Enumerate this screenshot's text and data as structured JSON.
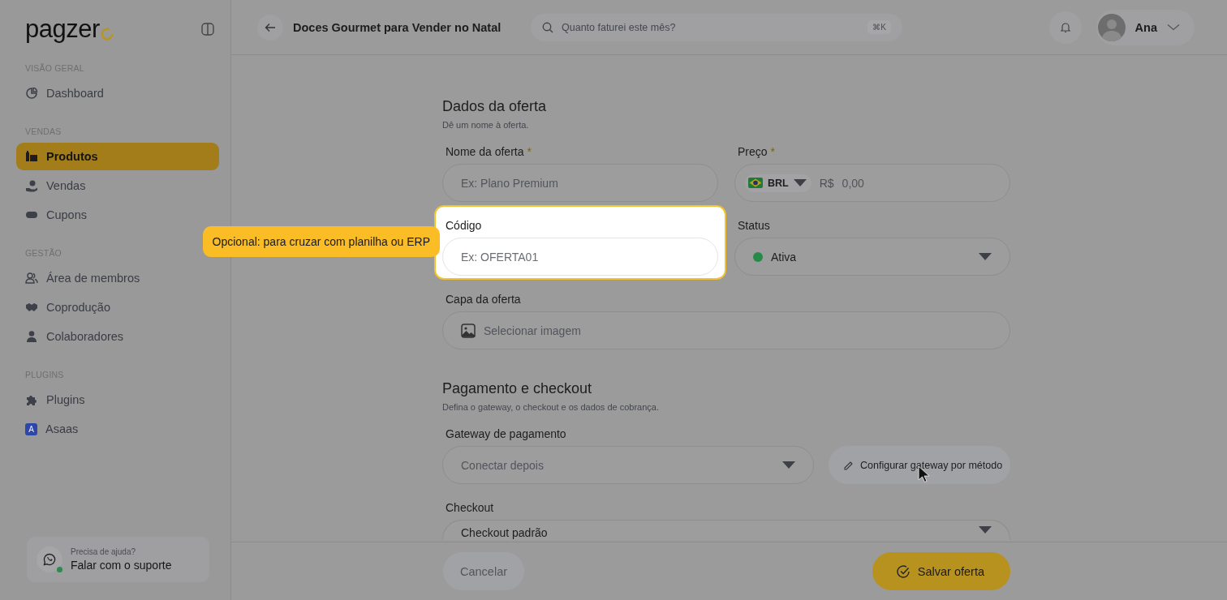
{
  "sidebar": {
    "logo": "pagzer",
    "sections": [
      {
        "title": "VISÃO GERAL",
        "items": [
          {
            "label": "Dashboard",
            "selected": false
          }
        ]
      },
      {
        "title": "VENDAS",
        "items": [
          {
            "label": "Produtos",
            "selected": true
          },
          {
            "label": "Vendas",
            "selected": false
          },
          {
            "label": "Cupons",
            "selected": false
          }
        ]
      },
      {
        "title": "GESTÃO",
        "items": [
          {
            "label": "Área de membros",
            "selected": false
          },
          {
            "label": "Coprodução",
            "selected": false
          },
          {
            "label": "Colaboradores",
            "selected": false
          }
        ]
      },
      {
        "title": "PLUGINS",
        "items": [
          {
            "label": "Plugins",
            "selected": false
          },
          {
            "label": "Asaas",
            "selected": false,
            "logo_letter": "A"
          }
        ]
      }
    ],
    "help": {
      "caption": "Precisa de ajuda?",
      "link": "Falar com o suporte"
    }
  },
  "header": {
    "title": "Doces Gourmet para Vender no Natal",
    "search": {
      "placeholder": "Quanto faturei este mês?",
      "shortcut": "⌘K"
    },
    "user": "Ana"
  },
  "sections": [
    {
      "title": "Dados da oferta",
      "subtitle": "Dê um nome à oferta.",
      "fields": [
        {
          "kind": "text",
          "label": "Nome da oferta",
          "required_mark": "*",
          "placeholder": "Ex: Plano Premium",
          "highlighted": false
        },
        {
          "kind": "price",
          "label": "Preço",
          "required_mark": "*",
          "currency": "BRL",
          "symbol": "R$",
          "placeholder": "0,00",
          "highlighted": false
        },
        {
          "kind": "text",
          "label": "Código",
          "placeholder": "Ex: OFERTA01",
          "highlighted": true,
          "tooltip": "Opcional: para cruzar com planilha ou ERP"
        },
        {
          "kind": "select",
          "label": "Status",
          "value": "Ativa",
          "highlighted": false
        },
        {
          "kind": "image",
          "label": "Capa da oferta",
          "placeholder": "Selecionar imagem",
          "highlighted": false
        }
      ]
    },
    {
      "title": "Pagamento e checkout",
      "subtitle": "Defina o gateway, o checkout e os dados de cobrança.",
      "fields": [
        {
          "kind": "gateway",
          "label": "Gateway de pagamento",
          "placeholder": "Conectar depois",
          "button": "Configurar gateway por método",
          "highlighted": false
        },
        {
          "kind": "select",
          "label": "Checkout",
          "value": "Checkout padrão",
          "highlighted": false
        }
      ]
    }
  ],
  "footer": {
    "cancel": "Cancelar",
    "save": "Salvar oferta"
  }
}
